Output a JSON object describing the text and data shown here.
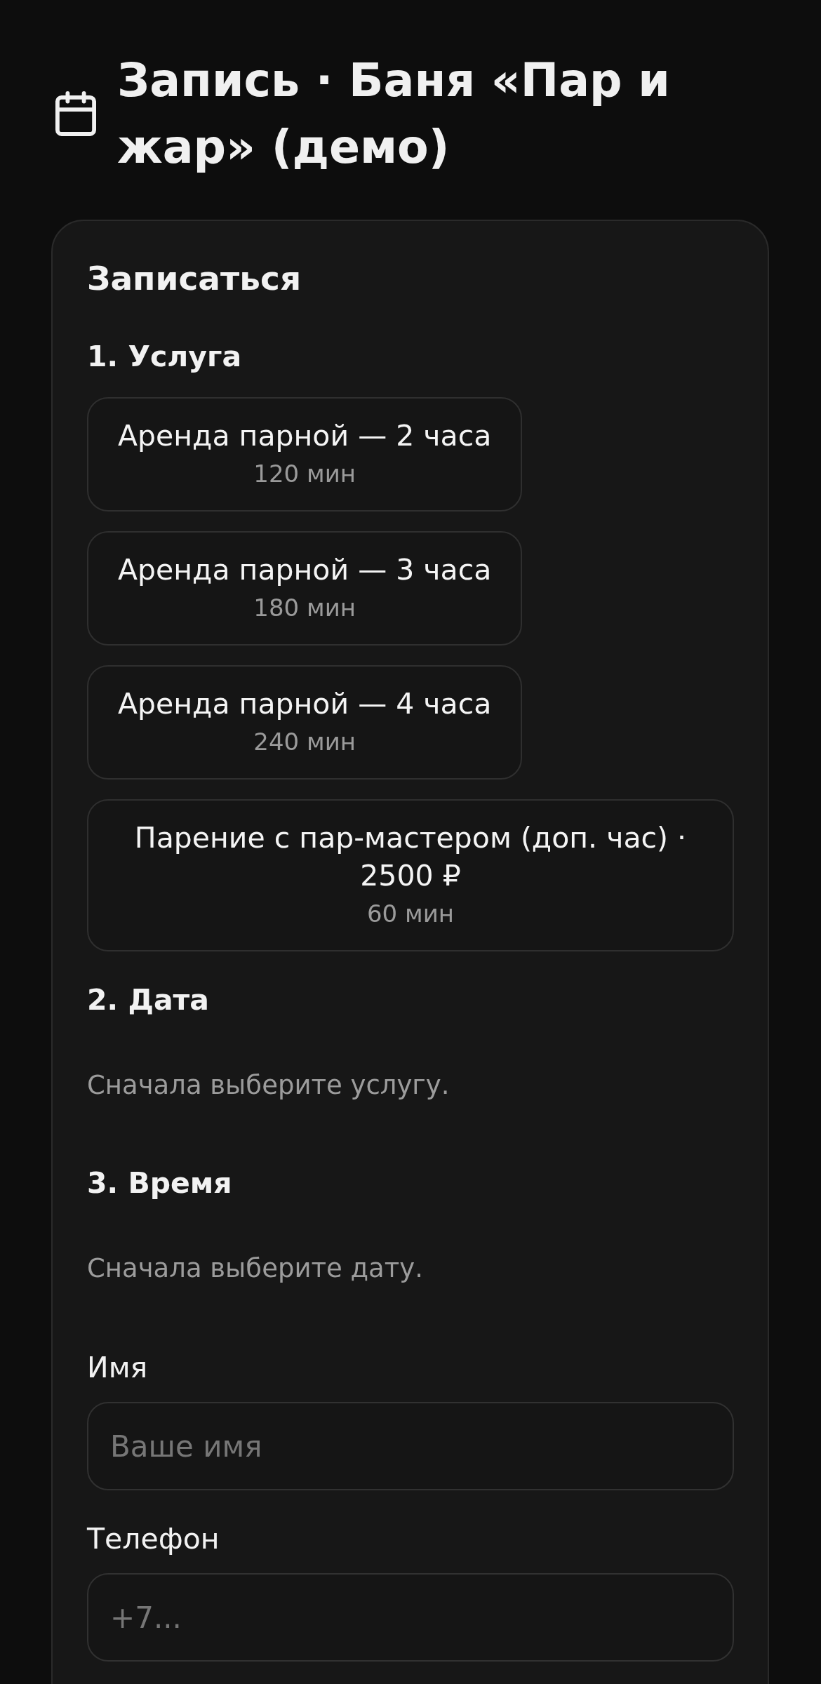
{
  "header": {
    "title": "Запись · Баня «Пар и жар» (демо)"
  },
  "booking_card": {
    "title": "Записаться",
    "steps": [
      {
        "kind": "services",
        "heading": "1. Услуга",
        "services": [
          {
            "name": "Аренда парной — 2 часа",
            "duration": "120 мин",
            "selected": false
          },
          {
            "name": "Аренда парной — 3 часа",
            "duration": "180 мин",
            "selected": false
          },
          {
            "name": "Аренда парной — 4 часа",
            "duration": "240 мин",
            "selected": false
          },
          {
            "name": "Парение с пар-мастером (доп. час) · 2500 ₽",
            "duration": "60 мин",
            "selected": false
          }
        ]
      },
      {
        "kind": "hint",
        "heading": "2. Дата",
        "hint": "Сначала выберите услугу."
      },
      {
        "kind": "hint",
        "heading": "3. Время",
        "hint": "Сначала выберите дату."
      }
    ],
    "fields": [
      {
        "label": "Имя",
        "placeholder": "Ваше имя"
      },
      {
        "label": "Телефон",
        "placeholder": "+7..."
      }
    ]
  }
}
